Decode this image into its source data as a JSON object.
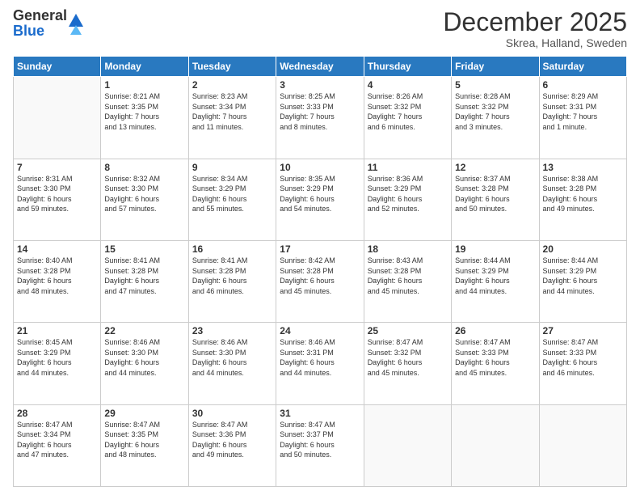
{
  "header": {
    "logo_general": "General",
    "logo_blue": "Blue",
    "month": "December 2025",
    "location": "Skrea, Halland, Sweden"
  },
  "days_of_week": [
    "Sunday",
    "Monday",
    "Tuesday",
    "Wednesday",
    "Thursday",
    "Friday",
    "Saturday"
  ],
  "weeks": [
    [
      {
        "day": "",
        "info": ""
      },
      {
        "day": "1",
        "info": "Sunrise: 8:21 AM\nSunset: 3:35 PM\nDaylight: 7 hours\nand 13 minutes."
      },
      {
        "day": "2",
        "info": "Sunrise: 8:23 AM\nSunset: 3:34 PM\nDaylight: 7 hours\nand 11 minutes."
      },
      {
        "day": "3",
        "info": "Sunrise: 8:25 AM\nSunset: 3:33 PM\nDaylight: 7 hours\nand 8 minutes."
      },
      {
        "day": "4",
        "info": "Sunrise: 8:26 AM\nSunset: 3:32 PM\nDaylight: 7 hours\nand 6 minutes."
      },
      {
        "day": "5",
        "info": "Sunrise: 8:28 AM\nSunset: 3:32 PM\nDaylight: 7 hours\nand 3 minutes."
      },
      {
        "day": "6",
        "info": "Sunrise: 8:29 AM\nSunset: 3:31 PM\nDaylight: 7 hours\nand 1 minute."
      }
    ],
    [
      {
        "day": "7",
        "info": "Sunrise: 8:31 AM\nSunset: 3:30 PM\nDaylight: 6 hours\nand 59 minutes."
      },
      {
        "day": "8",
        "info": "Sunrise: 8:32 AM\nSunset: 3:30 PM\nDaylight: 6 hours\nand 57 minutes."
      },
      {
        "day": "9",
        "info": "Sunrise: 8:34 AM\nSunset: 3:29 PM\nDaylight: 6 hours\nand 55 minutes."
      },
      {
        "day": "10",
        "info": "Sunrise: 8:35 AM\nSunset: 3:29 PM\nDaylight: 6 hours\nand 54 minutes."
      },
      {
        "day": "11",
        "info": "Sunrise: 8:36 AM\nSunset: 3:29 PM\nDaylight: 6 hours\nand 52 minutes."
      },
      {
        "day": "12",
        "info": "Sunrise: 8:37 AM\nSunset: 3:28 PM\nDaylight: 6 hours\nand 50 minutes."
      },
      {
        "day": "13",
        "info": "Sunrise: 8:38 AM\nSunset: 3:28 PM\nDaylight: 6 hours\nand 49 minutes."
      }
    ],
    [
      {
        "day": "14",
        "info": "Sunrise: 8:40 AM\nSunset: 3:28 PM\nDaylight: 6 hours\nand 48 minutes."
      },
      {
        "day": "15",
        "info": "Sunrise: 8:41 AM\nSunset: 3:28 PM\nDaylight: 6 hours\nand 47 minutes."
      },
      {
        "day": "16",
        "info": "Sunrise: 8:41 AM\nSunset: 3:28 PM\nDaylight: 6 hours\nand 46 minutes."
      },
      {
        "day": "17",
        "info": "Sunrise: 8:42 AM\nSunset: 3:28 PM\nDaylight: 6 hours\nand 45 minutes."
      },
      {
        "day": "18",
        "info": "Sunrise: 8:43 AM\nSunset: 3:28 PM\nDaylight: 6 hours\nand 45 minutes."
      },
      {
        "day": "19",
        "info": "Sunrise: 8:44 AM\nSunset: 3:29 PM\nDaylight: 6 hours\nand 44 minutes."
      },
      {
        "day": "20",
        "info": "Sunrise: 8:44 AM\nSunset: 3:29 PM\nDaylight: 6 hours\nand 44 minutes."
      }
    ],
    [
      {
        "day": "21",
        "info": "Sunrise: 8:45 AM\nSunset: 3:29 PM\nDaylight: 6 hours\nand 44 minutes."
      },
      {
        "day": "22",
        "info": "Sunrise: 8:46 AM\nSunset: 3:30 PM\nDaylight: 6 hours\nand 44 minutes."
      },
      {
        "day": "23",
        "info": "Sunrise: 8:46 AM\nSunset: 3:30 PM\nDaylight: 6 hours\nand 44 minutes."
      },
      {
        "day": "24",
        "info": "Sunrise: 8:46 AM\nSunset: 3:31 PM\nDaylight: 6 hours\nand 44 minutes."
      },
      {
        "day": "25",
        "info": "Sunrise: 8:47 AM\nSunset: 3:32 PM\nDaylight: 6 hours\nand 45 minutes."
      },
      {
        "day": "26",
        "info": "Sunrise: 8:47 AM\nSunset: 3:33 PM\nDaylight: 6 hours\nand 45 minutes."
      },
      {
        "day": "27",
        "info": "Sunrise: 8:47 AM\nSunset: 3:33 PM\nDaylight: 6 hours\nand 46 minutes."
      }
    ],
    [
      {
        "day": "28",
        "info": "Sunrise: 8:47 AM\nSunset: 3:34 PM\nDaylight: 6 hours\nand 47 minutes."
      },
      {
        "day": "29",
        "info": "Sunrise: 8:47 AM\nSunset: 3:35 PM\nDaylight: 6 hours\nand 48 minutes."
      },
      {
        "day": "30",
        "info": "Sunrise: 8:47 AM\nSunset: 3:36 PM\nDaylight: 6 hours\nand 49 minutes."
      },
      {
        "day": "31",
        "info": "Sunrise: 8:47 AM\nSunset: 3:37 PM\nDaylight: 6 hours\nand 50 minutes."
      },
      {
        "day": "",
        "info": ""
      },
      {
        "day": "",
        "info": ""
      },
      {
        "day": "",
        "info": ""
      }
    ]
  ]
}
